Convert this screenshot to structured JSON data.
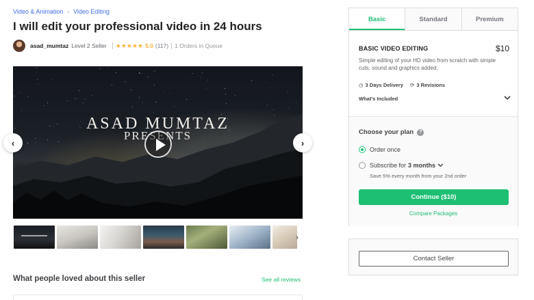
{
  "breadcrumb": {
    "items": [
      "Video & Animation",
      "Video Editing"
    ],
    "separator": "›"
  },
  "gig": {
    "title": "I will edit your professional video in 24 hours"
  },
  "seller": {
    "name": "asad_mumtaz",
    "level": "Level 2 Seller",
    "stars": "★★★★★",
    "rating": "5.0",
    "reviews": "(117)",
    "queue": "1 Orders in Queue"
  },
  "video": {
    "title": "ASAD MUMTAZ",
    "subtitle": "PRESENTS"
  },
  "gallery": {
    "prev_icon": "‹",
    "next_icon": "›",
    "thumb_next_icon": "›",
    "thumbnail_count": 7
  },
  "reviews_section": {
    "heading": "What people loved about this seller",
    "see_all": "See all reviews"
  },
  "package": {
    "tabs": [
      "Basic",
      "Standard",
      "Premium"
    ],
    "active_tab": "Basic",
    "name": "BASIC VIDEO EDITING",
    "price": "$10",
    "description": "Simple editing of your HD video from scratch with simple cuts, sound and graphics added.",
    "delivery": "3 Days Delivery",
    "revisions": "3 Revisions",
    "included": "What's Included",
    "choose_label": "Choose your plan",
    "help_icon": "?",
    "option_once": "Order once",
    "option_subscribe_prefix": "Subscribe for",
    "option_subscribe_value": "3 months",
    "save_note": "Save 5% every month from your 2nd order",
    "continue_label": "Continue ($10)",
    "compare_label": "Compare Packages"
  },
  "contact": {
    "label": "Contact Seller"
  },
  "colors": {
    "accent": "#1dbf73",
    "link": "#446ee7",
    "star": "#ffb33e"
  }
}
